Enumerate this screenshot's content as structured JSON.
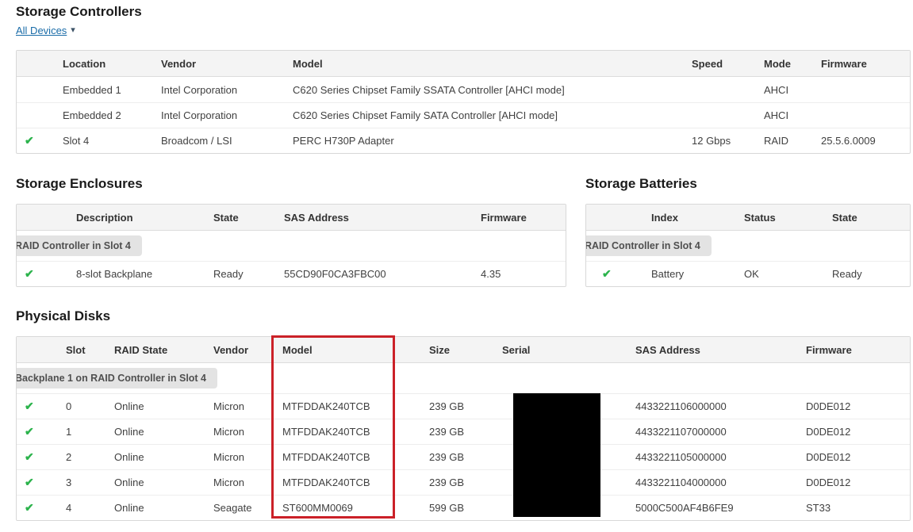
{
  "icons": {
    "check": "✔",
    "caret": "▾"
  },
  "colors": {
    "accent_link": "#1a6ca8",
    "status_ok_green": "#2cb34c",
    "annotation_red": "#cb2128",
    "redaction_black": "#000000",
    "table_header_bg": "#f4f4f4"
  },
  "controllers": {
    "heading": "Storage Controllers",
    "filter_label": "All Devices",
    "columns": [
      "Location",
      "Vendor",
      "Model",
      "Speed",
      "Mode",
      "Firmware"
    ],
    "rows": [
      {
        "status": "",
        "location": "Embedded 1",
        "vendor": "Intel Corporation",
        "model": "C620 Series Chipset Family SSATA Controller [AHCI mode]",
        "speed": "",
        "mode": "AHCI",
        "firmware": ""
      },
      {
        "status": "",
        "location": "Embedded 2",
        "vendor": "Intel Corporation",
        "model": "C620 Series Chipset Family SATA Controller [AHCI mode]",
        "speed": "",
        "mode": "AHCI",
        "firmware": ""
      },
      {
        "status": "ok",
        "location": "Slot 4",
        "vendor": "Broadcom / LSI",
        "model": "PERC H730P Adapter",
        "speed": "12 Gbps",
        "mode": "RAID",
        "firmware": "25.5.6.0009"
      }
    ]
  },
  "enclosures": {
    "heading": "Storage Enclosures",
    "columns": [
      "Description",
      "State",
      "SAS Address",
      "Firmware"
    ],
    "group_label": "RAID Controller in Slot 4",
    "rows": [
      {
        "status": "ok",
        "description": "8-slot Backplane",
        "state": "Ready",
        "sas_address": "55CD90F0CA3FBC00",
        "firmware": "4.35"
      }
    ]
  },
  "batteries": {
    "heading": "Storage Batteries",
    "columns": [
      "Index",
      "Status",
      "State"
    ],
    "group_label": "RAID Controller in Slot 4",
    "rows": [
      {
        "status": "ok",
        "index": "Battery",
        "battery_status": "OK",
        "state": "Ready"
      }
    ]
  },
  "disks": {
    "heading": "Physical Disks",
    "columns": [
      "Slot",
      "RAID State",
      "Vendor",
      "Model",
      "Size",
      "Serial",
      "SAS Address",
      "Firmware"
    ],
    "group_label": "Backplane 1 on RAID Controller in Slot 4",
    "rows": [
      {
        "status": "ok",
        "slot": "0",
        "raid_state": "Online",
        "vendor": "Micron",
        "model": "MTFDDAK240TCB",
        "size": "239 GB",
        "sas_address": "4433221106000000",
        "firmware": "D0DE012"
      },
      {
        "status": "ok",
        "slot": "1",
        "raid_state": "Online",
        "vendor": "Micron",
        "model": "MTFDDAK240TCB",
        "size": "239 GB",
        "sas_address": "4433221107000000",
        "firmware": "D0DE012"
      },
      {
        "status": "ok",
        "slot": "2",
        "raid_state": "Online",
        "vendor": "Micron",
        "model": "MTFDDAK240TCB",
        "size": "239 GB",
        "sas_address": "4433221105000000",
        "firmware": "D0DE012"
      },
      {
        "status": "ok",
        "slot": "3",
        "raid_state": "Online",
        "vendor": "Micron",
        "model": "MTFDDAK240TCB",
        "size": "239 GB",
        "sas_address": "4433221104000000",
        "firmware": "D0DE012"
      },
      {
        "status": "ok",
        "slot": "4",
        "raid_state": "Online",
        "vendor": "Seagate",
        "model": "ST600MM0069",
        "size": "599 GB",
        "sas_address": "5000C500AF4B6FE9",
        "firmware": "ST33"
      }
    ]
  }
}
